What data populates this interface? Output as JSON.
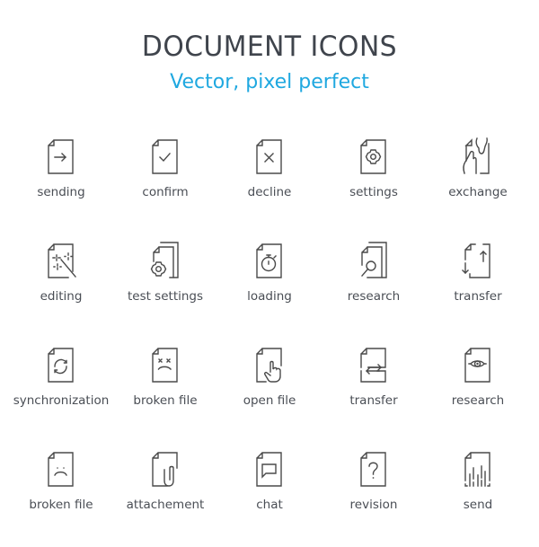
{
  "header": {
    "title": "DOCUMENT ICONS",
    "subtitle": "Vector, pixel perfect"
  },
  "colors": {
    "title": "#3f444c",
    "subtitle": "#1fa8e0",
    "icon_stroke": "#4a4a4a",
    "label": "#4a4e55"
  },
  "icons": [
    {
      "label": "sending",
      "icon": "document-arrow-right-icon"
    },
    {
      "label": "confirm",
      "icon": "document-checkmark-icon"
    },
    {
      "label": "decline",
      "icon": "document-x-icon"
    },
    {
      "label": "settings",
      "icon": "document-gear-icon"
    },
    {
      "label": "exchange",
      "icon": "hands-exchange-document-icon"
    },
    {
      "label": "editing",
      "icon": "document-magic-wand-icon"
    },
    {
      "label": "test settings",
      "icon": "documents-stack-gear-icon"
    },
    {
      "label": "loading",
      "icon": "document-stopwatch-icon"
    },
    {
      "label": "research",
      "icon": "documents-magnifier-icon"
    },
    {
      "label": "transfer",
      "icon": "document-arrows-up-down-icon"
    },
    {
      "label": "synchronization",
      "icon": "document-sync-arrows-icon"
    },
    {
      "label": "broken file",
      "icon": "document-dead-face-icon"
    },
    {
      "label": "open file",
      "icon": "document-pointing-hand-icon"
    },
    {
      "label": "transfer",
      "icon": "document-arrows-left-right-icon"
    },
    {
      "label": "research",
      "icon": "document-eye-icon"
    },
    {
      "label": "broken file",
      "icon": "document-sad-face-icon"
    },
    {
      "label": "attachement",
      "icon": "document-paperclip-icon"
    },
    {
      "label": "chat",
      "icon": "document-speech-bubble-icon"
    },
    {
      "label": "revision",
      "icon": "document-question-mark-icon"
    },
    {
      "label": "send",
      "icon": "document-shredded-icon"
    }
  ]
}
